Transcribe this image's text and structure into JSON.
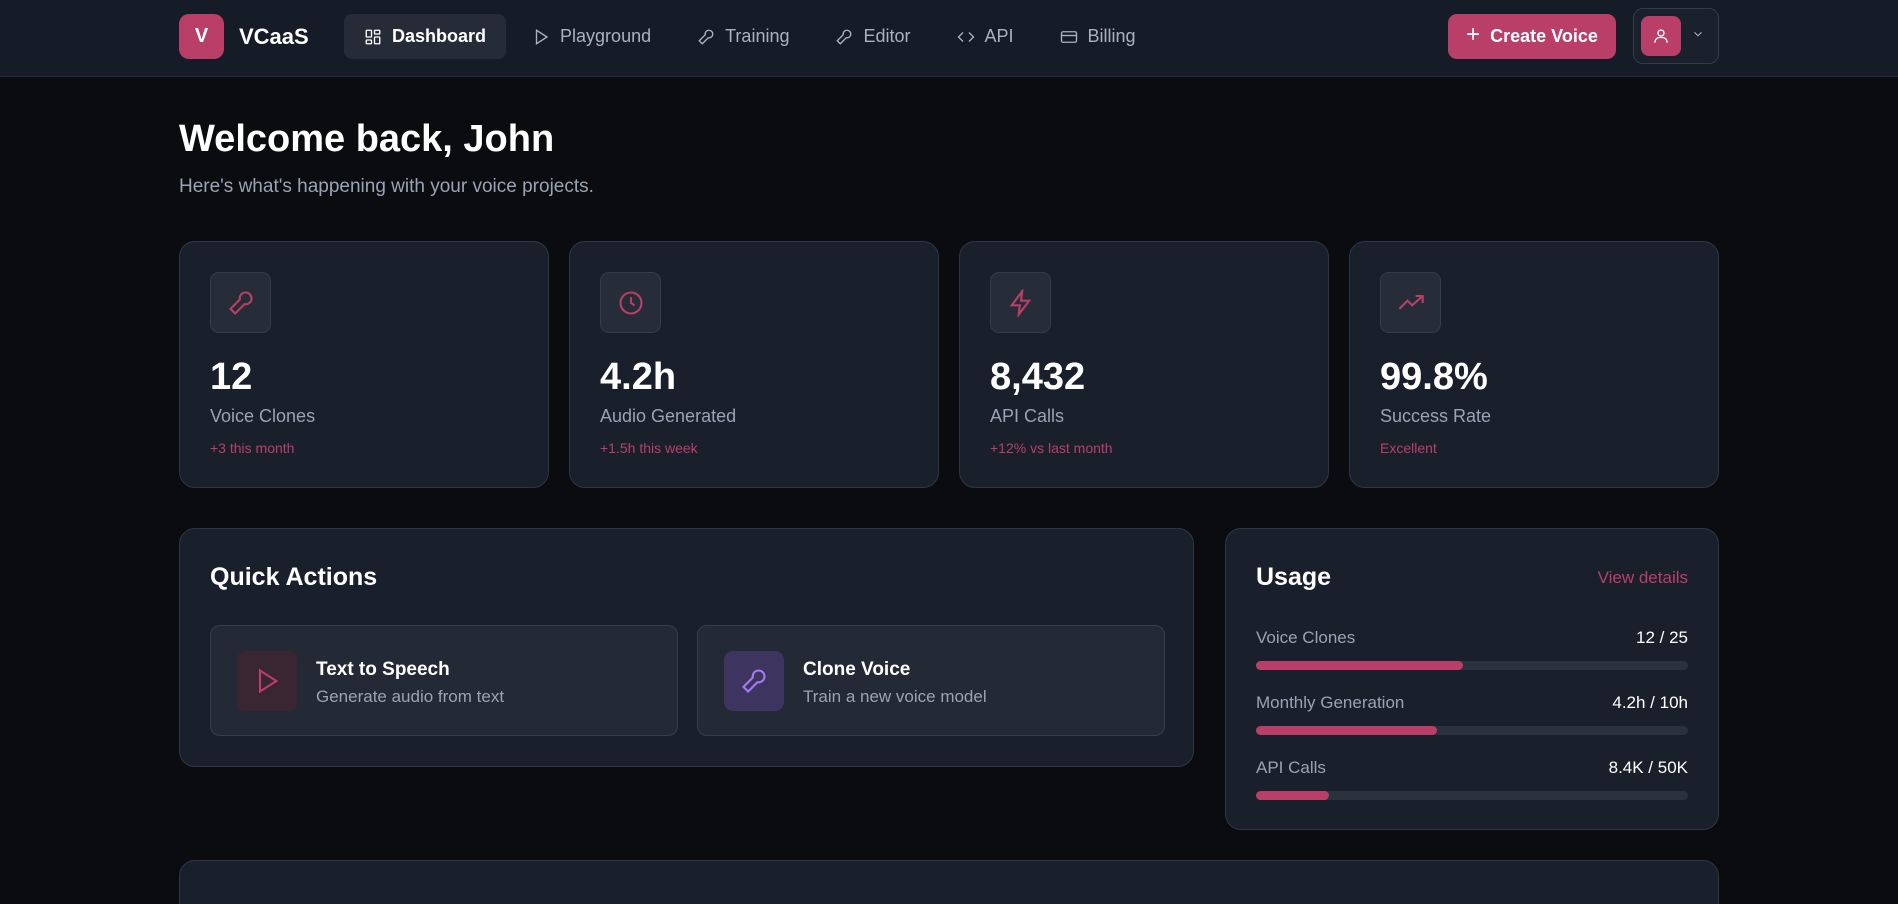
{
  "brand": {
    "logo_letter": "V",
    "name": "VCaaS"
  },
  "nav": {
    "items": [
      {
        "label": "Dashboard",
        "icon": "grid-icon",
        "active": true
      },
      {
        "label": "Playground",
        "icon": "play-icon",
        "active": false
      },
      {
        "label": "Training",
        "icon": "mic-icon",
        "active": false
      },
      {
        "label": "Editor",
        "icon": "pen-icon",
        "active": false
      },
      {
        "label": "API",
        "icon": "code-icon",
        "active": false
      },
      {
        "label": "Billing",
        "icon": "card-icon",
        "active": false
      }
    ]
  },
  "header_actions": {
    "create_label": "Create Voice"
  },
  "welcome": {
    "title": "Welcome back, John",
    "subtitle": "Here's what's happening with your voice projects."
  },
  "stats": [
    {
      "icon": "microphone-icon",
      "value": "12",
      "label": "Voice Clones",
      "note": "+3 this month"
    },
    {
      "icon": "clock-icon",
      "value": "4.2h",
      "label": "Audio Generated",
      "note": "+1.5h this week"
    },
    {
      "icon": "lightning-icon",
      "value": "8,432",
      "label": "API Calls",
      "note": "+12% vs last month"
    },
    {
      "icon": "trending-up-icon",
      "value": "99.8%",
      "label": "Success Rate",
      "note": "Excellent"
    }
  ],
  "quick_actions": {
    "title": "Quick Actions",
    "items": [
      {
        "icon": "play-icon",
        "title": "Text to Speech",
        "desc": "Generate audio from text"
      },
      {
        "icon": "microphone-icon",
        "title": "Clone Voice",
        "desc": "Train a new voice model"
      }
    ]
  },
  "usage": {
    "title": "Usage",
    "link": "View details",
    "rows": [
      {
        "name": "Voice Clones",
        "value": "12 / 25",
        "fraction": 0.48
      },
      {
        "name": "Monthly Generation",
        "value": "4.2h / 10h",
        "fraction": 0.42
      },
      {
        "name": "API Calls",
        "value": "8.4K / 50K",
        "fraction": 0.17
      }
    ]
  },
  "colors": {
    "accent": "#b93f68",
    "background": "#0b0c10",
    "card": "#1a202b",
    "clone_icon": "#a77bf0"
  }
}
